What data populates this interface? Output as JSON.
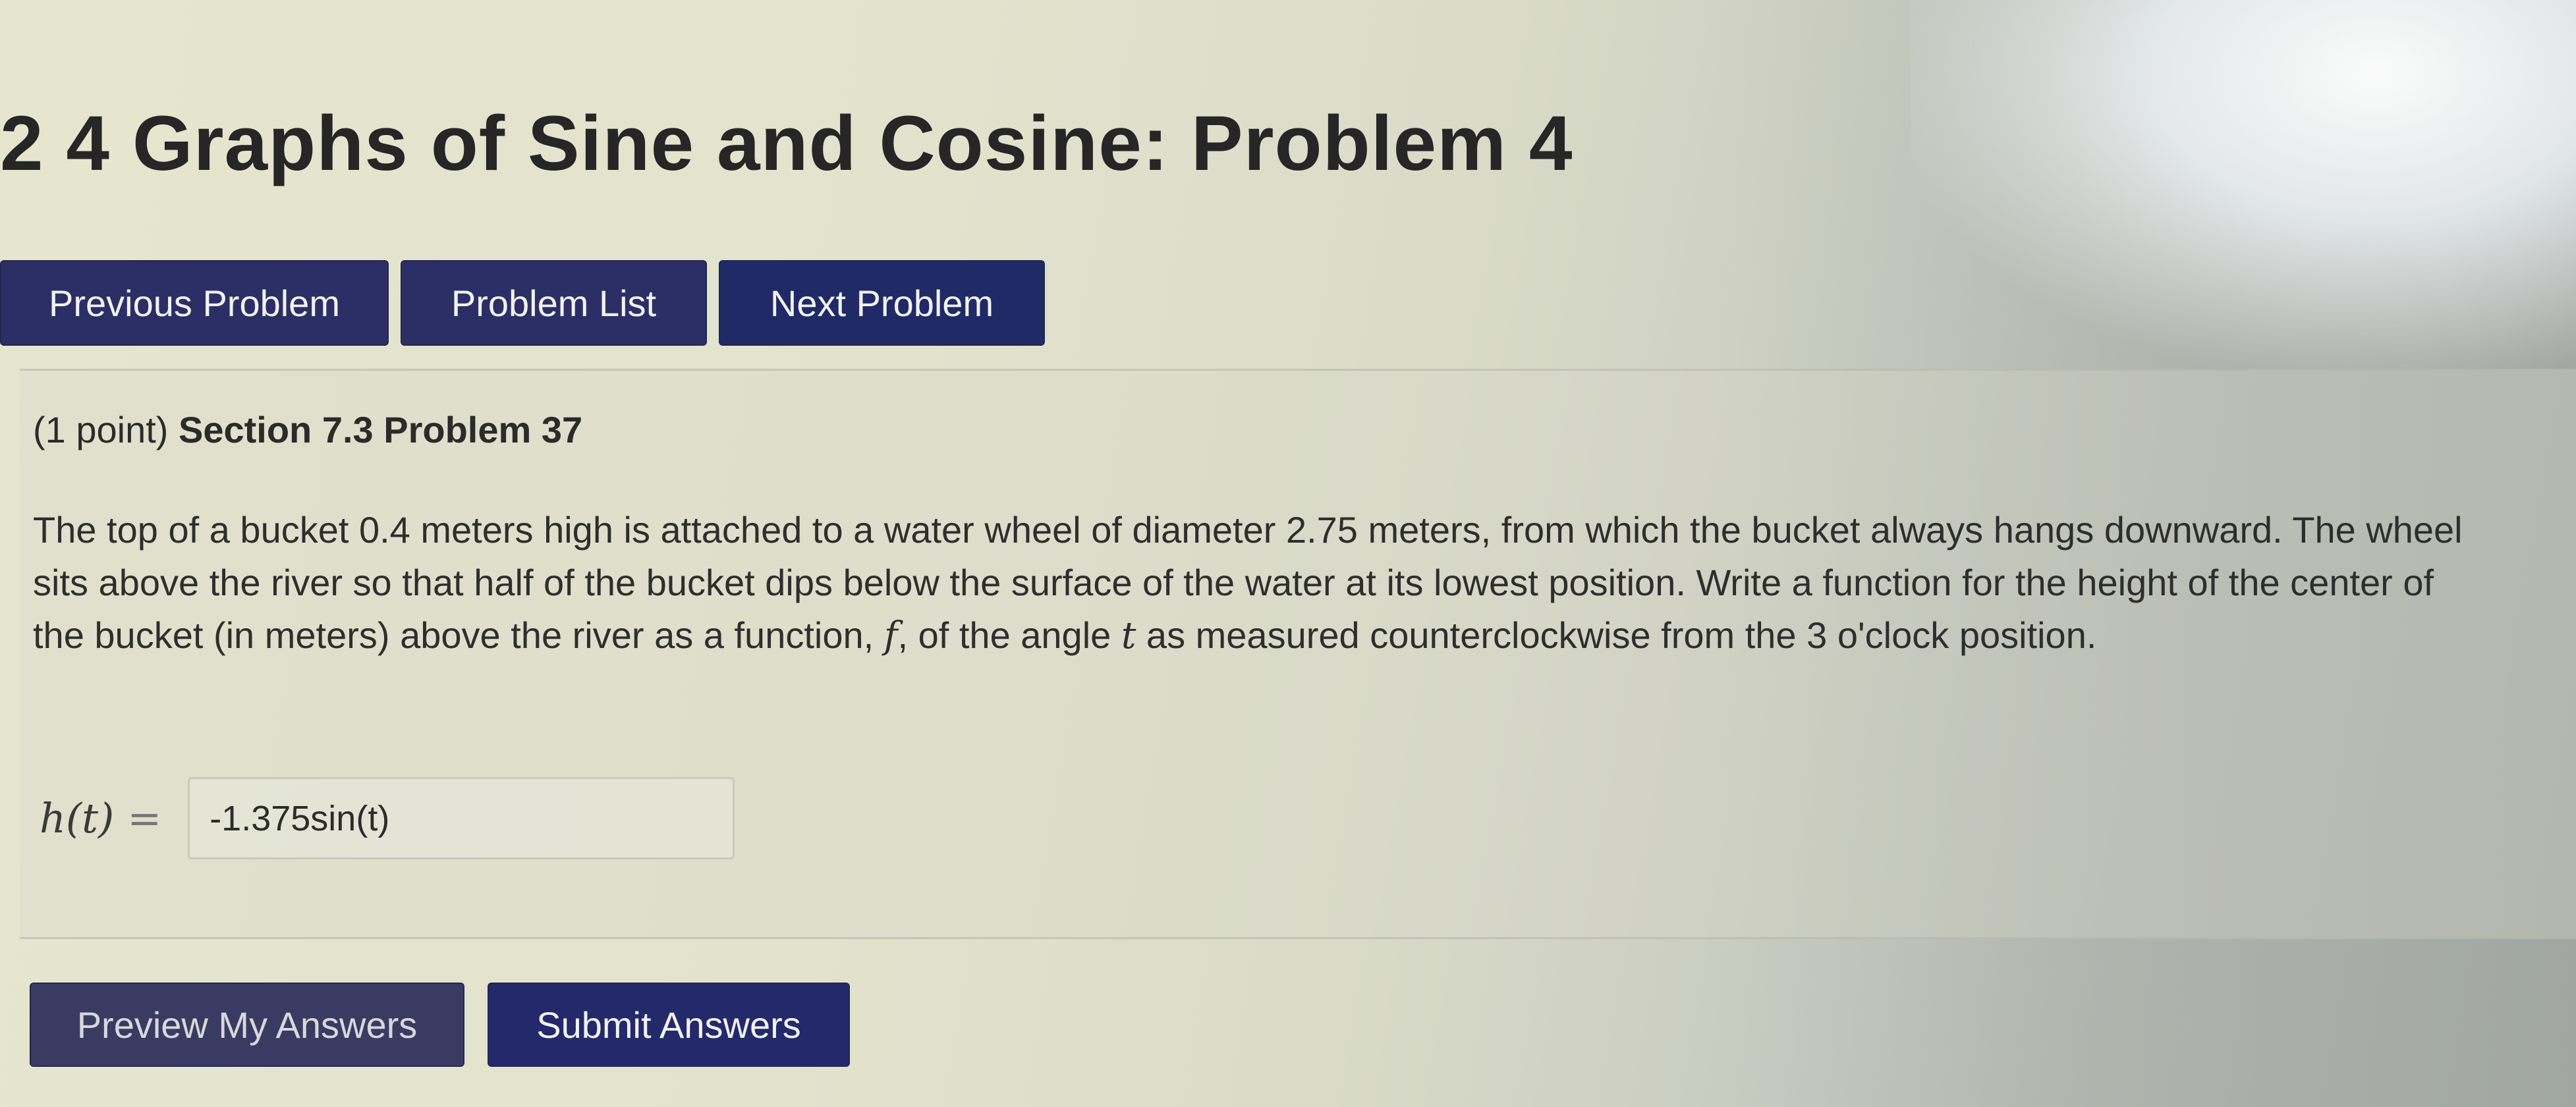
{
  "page": {
    "title": "2 4 Graphs of Sine and Cosine: Problem 4"
  },
  "nav": {
    "previous_label": "Previous Problem",
    "list_label": "Problem List",
    "next_label": "Next Problem"
  },
  "problem": {
    "points": "(1 point)",
    "section": "Section 7.3 Problem 37",
    "text_part1": "The top of a bucket 0.4 meters high is attached to a water wheel of diameter 2.75 meters, from which the bucket always hangs downward. The wheel sits above the river so that half of the bucket dips below the surface of the water at its lowest position. Write a function for the height of the center of the bucket (in meters) above the river as a function, ",
    "var_f": "f",
    "text_part2": ", of the angle ",
    "var_t": "t",
    "text_part3": " as measured counterclockwise from the 3 o'clock position."
  },
  "answer": {
    "label": "h(t)",
    "equals": "=",
    "value": "-1.375sin(t)"
  },
  "actions": {
    "preview_label": "Preview My Answers",
    "submit_label": "Submit Answers"
  },
  "colors": {
    "button_bg": "#2c2f66",
    "button_text": "#f2f2f2",
    "page_bg": "#e2e3cd"
  }
}
